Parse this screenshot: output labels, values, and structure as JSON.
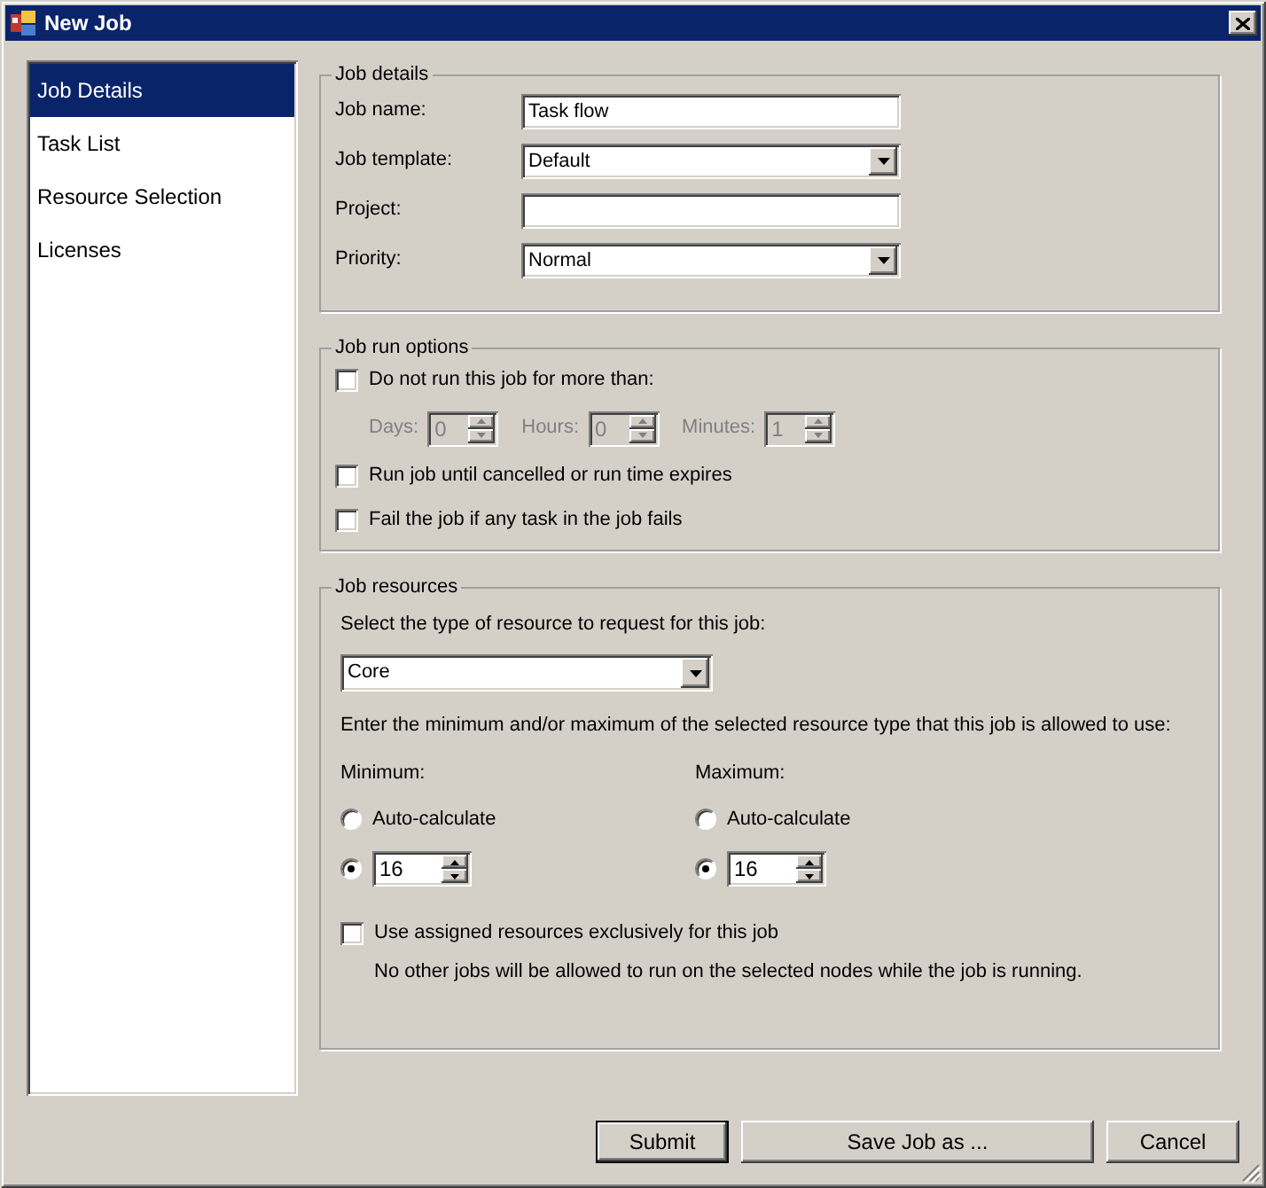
{
  "window": {
    "title": "New Job"
  },
  "sidebar": {
    "items": [
      {
        "label": "Job Details",
        "selected": true
      },
      {
        "label": "Task List",
        "selected": false
      },
      {
        "label": "Resource Selection",
        "selected": false
      },
      {
        "label": "Licenses",
        "selected": false
      }
    ]
  },
  "job_details": {
    "title": "Job details",
    "fields": [
      {
        "kind": "text",
        "label": "Job name:",
        "value": "Task flow"
      },
      {
        "kind": "dropdown",
        "label": "Job template:",
        "value": "Default"
      },
      {
        "kind": "text",
        "label": "Project:"
      },
      {
        "kind": "dropdown",
        "label": "Priority:",
        "value": "Normal"
      }
    ]
  },
  "job_run_options": {
    "title": "Job run options",
    "items": [
      {
        "kind": "checkbox",
        "label": "Do not run this job for more than:",
        "checked": false
      },
      {
        "kind": "spinners",
        "spinners": [
          {
            "label": "Days:",
            "value": "0",
            "disabled": true
          },
          {
            "label": "Hours:",
            "value": "0",
            "disabled": true
          },
          {
            "label": "Minutes:",
            "value": "1",
            "disabled": true
          }
        ]
      },
      {
        "kind": "checkbox",
        "label": "Run job until cancelled or run time expires",
        "checked": false
      },
      {
        "kind": "checkbox",
        "label": "Fail the job if any task in the job fails",
        "checked": false
      }
    ]
  },
  "job_resources": {
    "title": "Job resources",
    "type_prompt": "Select the type of resource to request for this job:",
    "resource_type": "Core",
    "range_prompt": "Enter the minimum and/or maximum of the selected resource type that this job is allowed to use:",
    "limits": [
      {
        "label": "Minimum:",
        "options": [
          {
            "kind": "radio",
            "label": "Auto-calculate",
            "selected": false
          },
          {
            "kind": "spinner",
            "value": "16",
            "selected": true
          }
        ]
      },
      {
        "label": "Maximum:",
        "options": [
          {
            "kind": "radio",
            "label": "Auto-calculate",
            "selected": false
          },
          {
            "kind": "spinner",
            "value": "16",
            "selected": true
          }
        ]
      }
    ],
    "exclusive": {
      "label": "Use assigned resources exclusively for this job",
      "checked": false
    },
    "exclusive_note": "No other jobs will be allowed to run on the selected nodes while the job is running."
  },
  "buttons": [
    {
      "label": "Submit",
      "default": true
    },
    {
      "label": "Save Job as ...",
      "default": false
    },
    {
      "label": "Cancel",
      "default": false
    }
  ]
}
